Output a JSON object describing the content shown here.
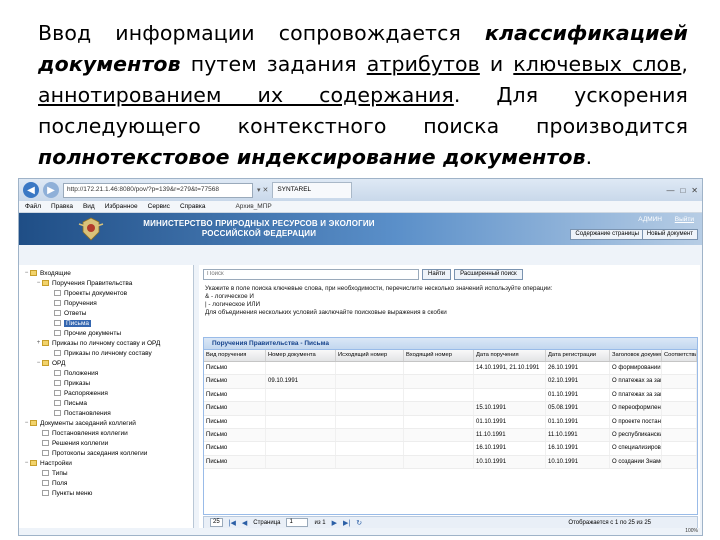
{
  "slide": {
    "p1": "Ввод информации сопровождается ",
    "p2": "классификацией документов",
    "p3": " путем задания ",
    "p4": "атрибутов",
    "p5": " и ",
    "p6": "ключевых слов",
    "p7": ", ",
    "p8": "аннотированием их содержания",
    "p9": ". Для ускорения последующего контекстного поиска производится ",
    "p10": "полнотекстовое индексирование документов",
    "p11": "."
  },
  "browser": {
    "url": "http://172.21.1.46:8080/pov/?p=139&r=279&t=77568",
    "tab_title": "SYNTAREL",
    "url_controls": "▾ ✕",
    "menu": [
      "Файл",
      "Правка",
      "Вид",
      "Избранное",
      "Сервис",
      "Справка"
    ],
    "fav_label": "Архив_МПР"
  },
  "app": {
    "title_line1": "МИНИСТЕРСТВО ПРИРОДНЫХ РЕСУРСОВ И ЭКОЛОГИИ",
    "title_line2": "РОССИЙСКОЙ ФЕДЕРАЦИИ",
    "user": "АДМИН",
    "exit": "Выйти",
    "btn_contents": "Содержание страницы",
    "btn_new_search": "Новый документ"
  },
  "tree": [
    {
      "label": "Входящие",
      "level": 0,
      "folder": true,
      "toggle": "−"
    },
    {
      "label": "Поручения Правительства",
      "level": 1,
      "folder": true,
      "toggle": "−"
    },
    {
      "label": "Проекты документов",
      "level": 2,
      "folder": false
    },
    {
      "label": "Поручения",
      "level": 2,
      "folder": false
    },
    {
      "label": "Ответы",
      "level": 2,
      "folder": false
    },
    {
      "label": "Письма",
      "level": 2,
      "folder": false,
      "active": true
    },
    {
      "label": "Прочие документы",
      "level": 2,
      "folder": false
    },
    {
      "label": "Приказы по личному составу и ОРД",
      "level": 1,
      "folder": true,
      "toggle": "+"
    },
    {
      "label": "Приказы по личному составу",
      "level": 2,
      "folder": false
    },
    {
      "label": "ОРД",
      "level": 1,
      "folder": true,
      "toggle": "−"
    },
    {
      "label": "Положения",
      "level": 2,
      "folder": false
    },
    {
      "label": "Приказы",
      "level": 2,
      "folder": false
    },
    {
      "label": "Распоряжения",
      "level": 2,
      "folder": false
    },
    {
      "label": "Письма",
      "level": 2,
      "folder": false
    },
    {
      "label": "Постановления",
      "level": 2,
      "folder": false
    },
    {
      "label": "Документы заседаний коллегий",
      "level": 0,
      "folder": true,
      "toggle": "−"
    },
    {
      "label": "Постановления коллегии",
      "level": 1,
      "folder": false
    },
    {
      "label": "Решения коллегии",
      "level": 1,
      "folder": false
    },
    {
      "label": "Протоколы заседания коллегии",
      "level": 1,
      "folder": false
    },
    {
      "label": "Настройки",
      "level": 0,
      "folder": true,
      "toggle": "−"
    },
    {
      "label": "Типы",
      "level": 1,
      "folder": false
    },
    {
      "label": "Поля",
      "level": 1,
      "folder": false
    },
    {
      "label": "Пункты меню",
      "level": 1,
      "folder": false
    }
  ],
  "search": {
    "placeholder": "Поиск",
    "find_label": "Найти",
    "advanced_label": "Расширенный поиск",
    "help_line1": "Укажите в поле поиска ключевые слова, при необходимости, перечислите несколько значений используйте операции:",
    "help_line2": "& - логическое И",
    "help_line3": "| - логическое ИЛИ",
    "help_line4": "Для объединения нескольких условий заключайте поисковые выражения в скобки"
  },
  "grid": {
    "title": "Поручения Правительства - Письма",
    "columns": [
      "Вид поручения",
      "Номер документа",
      "Исходящий номер",
      "Входящий номер",
      "Дата поручения",
      "Дата регистрации",
      "Заголовок документа",
      "Соответствие фонду"
    ],
    "rows": [
      [
        "Письмо",
        "",
        "",
        "",
        "14.10.1991, 21.10.1991",
        "26.10.1991",
        "О формировании стран Министерства экологии",
        ""
      ],
      [
        "Письмо",
        "09.10.1991",
        "",
        "",
        "",
        "02.10.1991",
        "О платежах за загрязн.Министерство экологии",
        ""
      ],
      [
        "Письмо",
        "",
        "",
        "",
        "",
        "01.10.1991",
        "О платежах за загрязн.Министерство экологии",
        ""
      ],
      [
        "Письмо",
        "",
        "",
        "",
        "15.10.1991",
        "05.08.1991",
        "О переоформлении печ.Министерство экологии",
        ""
      ],
      [
        "Письмо",
        "",
        "",
        "",
        "01.10.1991",
        "01.10.1991",
        "О проекте постановле.Министерство экологии",
        ""
      ],
      [
        "Письмо",
        "",
        "",
        "",
        "11.10.1991",
        "11.10.1991",
        "О республиканских чле.Министерство экологии",
        ""
      ],
      [
        "Письмо",
        "",
        "",
        "",
        "16.10.1991",
        "16.10.1991",
        "О специализированных.Министерство экологии",
        ""
      ],
      [
        "Письмо",
        "",
        "",
        "",
        "10.10.1991",
        "10.10.1991",
        "О создании Знаменита.Министерство экологии",
        ""
      ]
    ]
  },
  "pager": {
    "page_size": "25",
    "page_label": "Страница",
    "page_value": "1",
    "page_of": "из 1",
    "status": "Отображается с 1 по 25 из 25"
  },
  "statusbar": "100%"
}
